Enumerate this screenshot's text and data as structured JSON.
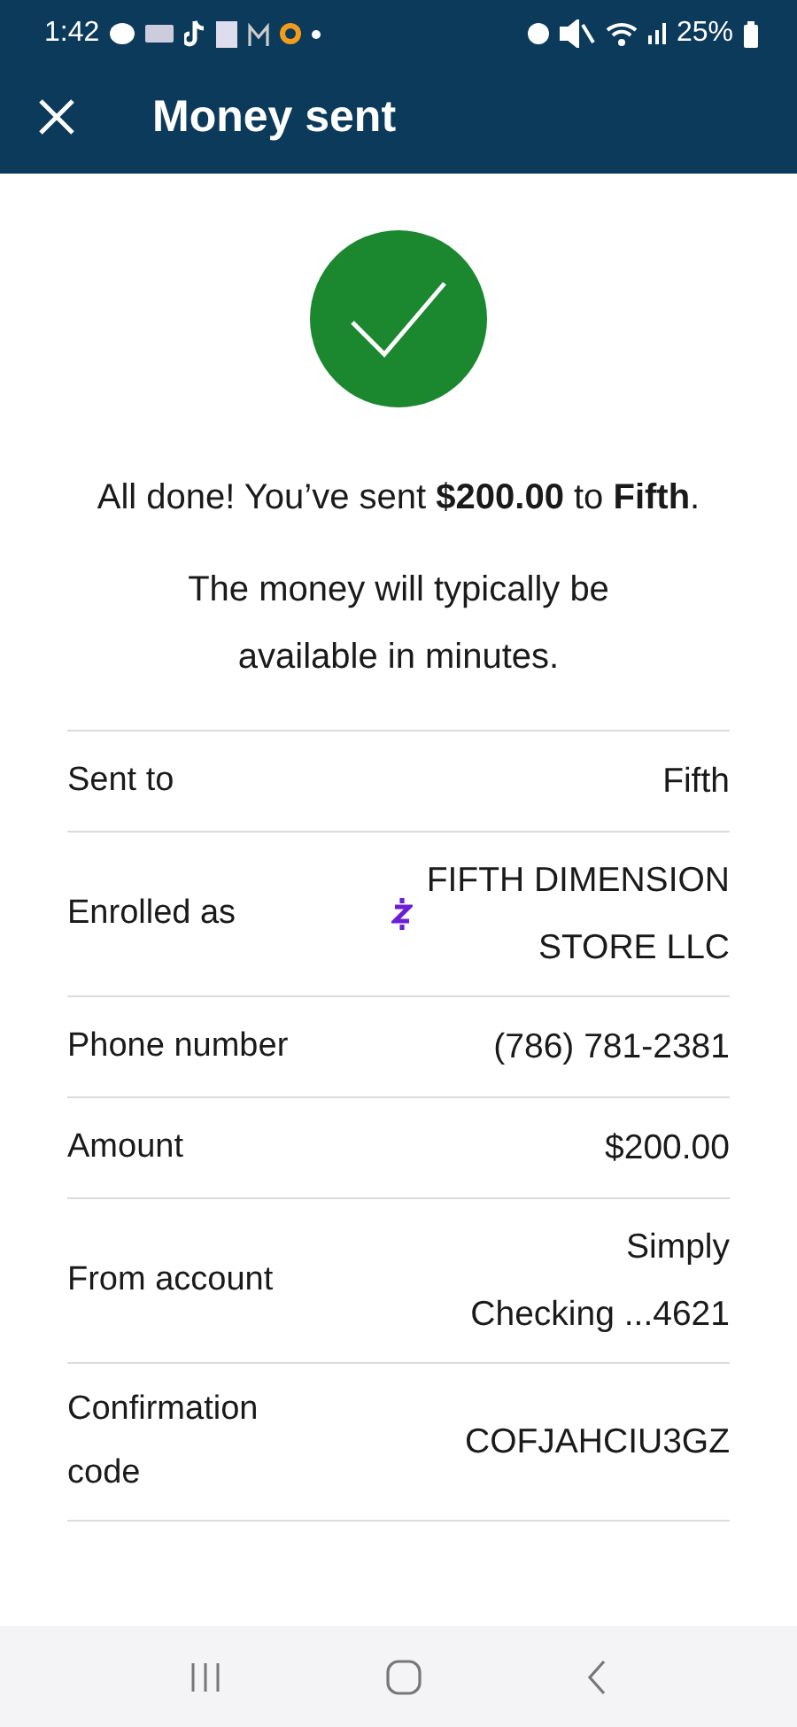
{
  "status_bar": {
    "time": "1:42",
    "battery": "25%"
  },
  "header": {
    "title": "Money sent"
  },
  "message": {
    "text": "All done! You’ve sent **$200.00** to **Fifth**.",
    "note": "The money will typically be available in minutes."
  },
  "details": [
    {
      "label": "Sent to",
      "value_lines": [
        "Fifth"
      ]
    },
    {
      "label": "Enrolled as",
      "value_lines": [
        "FIFTH DIMENSION",
        "STORE LLC"
      ],
      "kind": "zelle"
    },
    {
      "label": "Phone number",
      "value_lines": [
        "(786) 781-2381"
      ]
    },
    {
      "label": "Amount",
      "value_lines": [
        "$200.00"
      ]
    },
    {
      "label": "From account",
      "value_lines": [
        "Simply",
        "Checking ...4621"
      ]
    },
    {
      "label": "Confirmation code",
      "value_lines": [
        "COFJAHCIU3GZ"
      ]
    }
  ]
}
